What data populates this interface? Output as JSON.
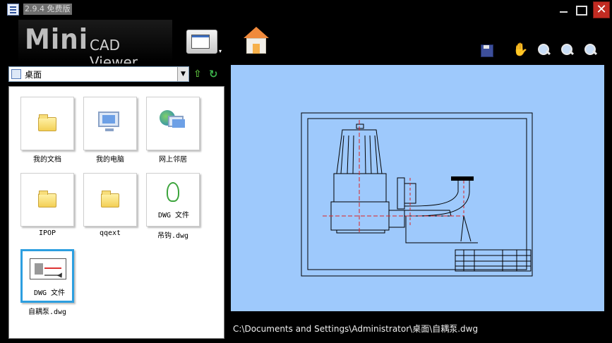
{
  "window": {
    "title": "2.9.4 免费版",
    "controls": {
      "minimize": "",
      "maximize": "",
      "close": "✕"
    }
  },
  "toolbar": {
    "logo_main": "Mini",
    "logo_rest": "CAD Viewer",
    "dropdown_arrow": "▾",
    "hand_glyph": "✋",
    "icons": [
      "view-mode-icon",
      "home-icon",
      "save-icon",
      "pan-hand-icon",
      "zoom-window-icon",
      "zoom-in-icon",
      "zoom-out-icon"
    ]
  },
  "address": {
    "location": "桌面",
    "dropdown_arrow": "▼",
    "up_glyph": "⇧",
    "refresh_glyph": "↻"
  },
  "files": [
    {
      "name": "我的文档",
      "type": "folder"
    },
    {
      "name": "我的电脑",
      "type": "computer"
    },
    {
      "name": "网上邻居",
      "type": "network"
    },
    {
      "name": "IPOP",
      "type": "folder"
    },
    {
      "name": "qqext",
      "type": "folder"
    },
    {
      "name": "吊钩.dwg",
      "type": "dwg",
      "badge": "DWG 文件"
    },
    {
      "name": "自耦泵.dwg",
      "type": "dwg",
      "badge": "DWG 文件",
      "selected": true
    }
  ],
  "status": {
    "path": "C:\\Documents and Settings\\Administrator\\桌面\\自耦泵.dwg"
  },
  "colors": {
    "viewer_bg": "#9ec9fc",
    "selection": "#2d9fe0",
    "close_button": "#c22b22"
  }
}
